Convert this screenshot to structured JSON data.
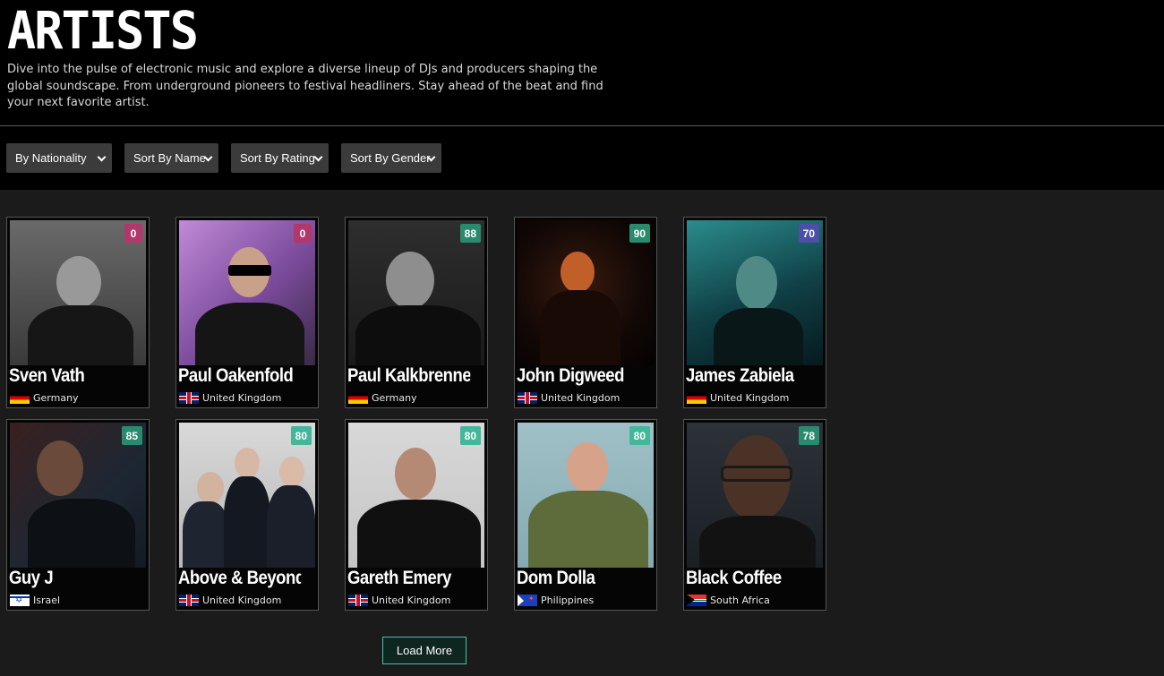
{
  "header": {
    "title": "ARTISTS",
    "description": "Dive into the pulse of electronic music and explore a diverse lineup of DJs and producers shaping the global soundscape. From underground pioneers to festival headliners. Stay ahead of the beat and find your next favorite artist."
  },
  "filters": [
    {
      "label": "By Nationality",
      "icon": "chevron-down-icon"
    },
    {
      "label": "Sort By Name",
      "icon": "chevron-down-icon"
    },
    {
      "label": "Sort By Rating",
      "icon": "chevron-down-icon"
    },
    {
      "label": "Sort By Gender",
      "icon": "chevron-down-icon"
    }
  ],
  "artists": [
    {
      "name": "Sven Vath",
      "country": "Germany",
      "flag": "flag-germany-icon",
      "rating": "0",
      "badge_color": "#b0386a"
    },
    {
      "name": "Paul Oakenfold",
      "country": "United Kingdom",
      "flag": "flag-uk-icon",
      "rating": "0",
      "badge_color": "#b0386a"
    },
    {
      "name": "Paul Kalkbrenner",
      "country": "Germany",
      "flag": "flag-germany-icon",
      "rating": "88",
      "badge_color": "#2a8a6e"
    },
    {
      "name": "John Digweed",
      "country": "United Kingdom",
      "flag": "flag-uk-icon",
      "rating": "90",
      "badge_color": "#2a8a6e"
    },
    {
      "name": "James Zabiela",
      "country": "United Kingdom",
      "flag": "flag-germany-icon",
      "rating": "70",
      "badge_color": "#4b4fa8"
    },
    {
      "name": "Guy J",
      "country": "Israel",
      "flag": "flag-israel-icon",
      "rating": "85",
      "badge_color": "#2a8a6e"
    },
    {
      "name": "Above & Beyond",
      "country": "United Kingdom",
      "flag": "flag-uk-icon",
      "rating": "80",
      "badge_color": "#43b79a"
    },
    {
      "name": "Gareth Emery",
      "country": "United Kingdom",
      "flag": "flag-uk-icon",
      "rating": "80",
      "badge_color": "#43b79a"
    },
    {
      "name": "Dom Dolla",
      "country": "Philippines",
      "flag": "flag-philippines-icon",
      "rating": "80",
      "badge_color": "#43b79a"
    },
    {
      "name": "Black Coffee",
      "country": "South Africa",
      "flag": "flag-south-africa-icon",
      "rating": "78",
      "badge_color": "#2a8a6e"
    }
  ],
  "load_more_label": "Load More"
}
